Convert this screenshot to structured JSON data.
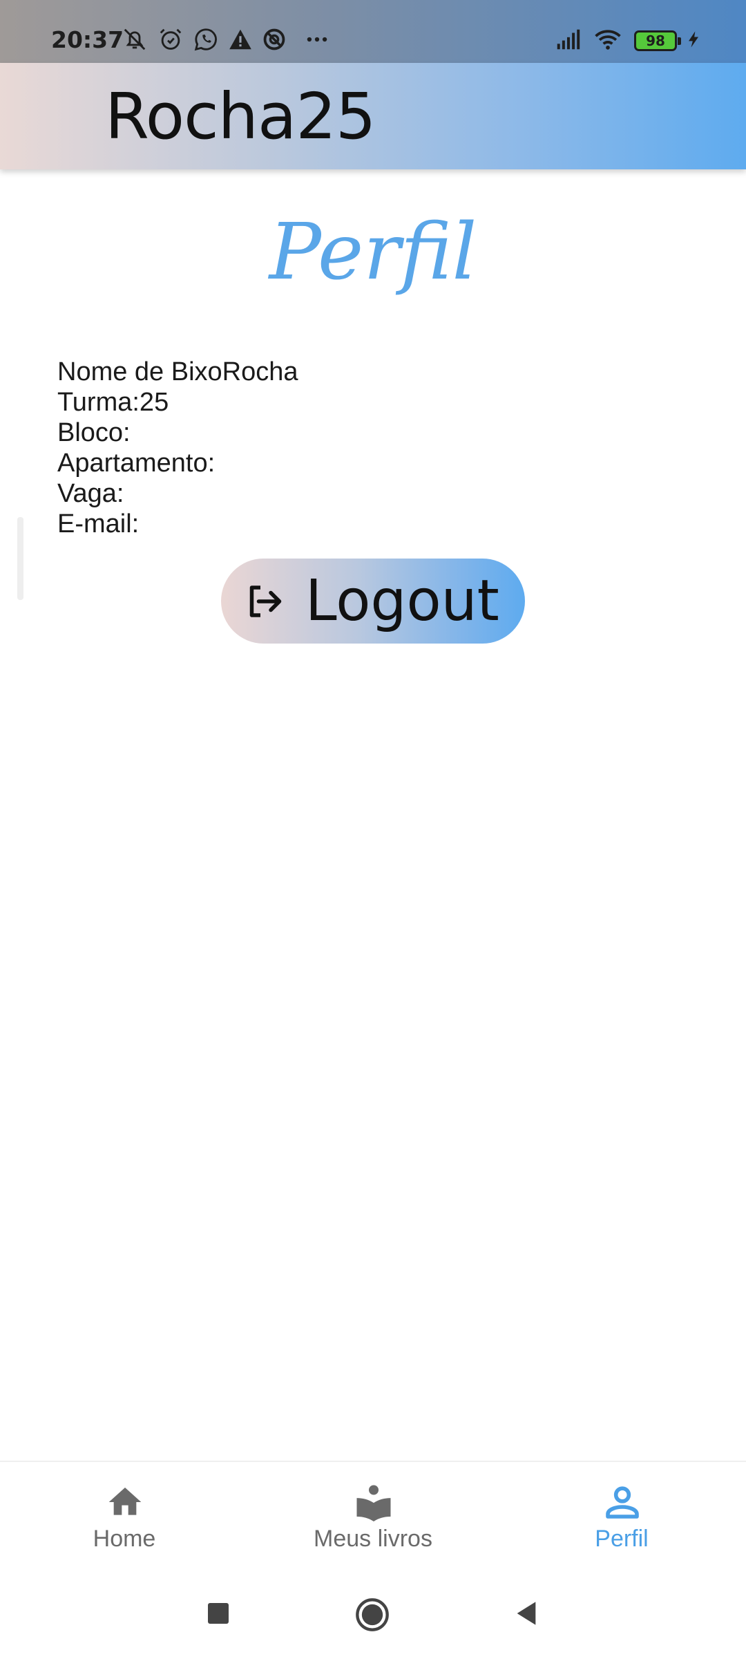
{
  "status_bar": {
    "time": "20:37",
    "battery": "98",
    "icons": [
      "bell-off-icon",
      "alarm-icon",
      "whatsapp-icon",
      "warning-icon",
      "circle-icon",
      "more-dots-icon",
      "signal-icon",
      "wifi-icon",
      "battery-icon",
      "charging-icon"
    ]
  },
  "app_bar": {
    "title": "Rocha25"
  },
  "page": {
    "heading": "Perfil"
  },
  "profile": {
    "name": "Nome de BixoRocha",
    "turma": "Turma:25",
    "bloco": "Bloco:",
    "apartamento": "Apartamento:",
    "vaga": "Vaga:",
    "email": "E-mail:"
  },
  "logout": {
    "label": "Logout",
    "icon": "logout-icon"
  },
  "bottom_nav": {
    "items": [
      {
        "label": "Home",
        "icon": "home-icon",
        "active": false
      },
      {
        "label": "Meus livros",
        "icon": "book-reader-icon",
        "active": false
      },
      {
        "label": "Perfil",
        "icon": "person-icon",
        "active": true
      }
    ]
  },
  "colors": {
    "accent": "#5aa6e8",
    "inactive": "#6a6a6a"
  }
}
